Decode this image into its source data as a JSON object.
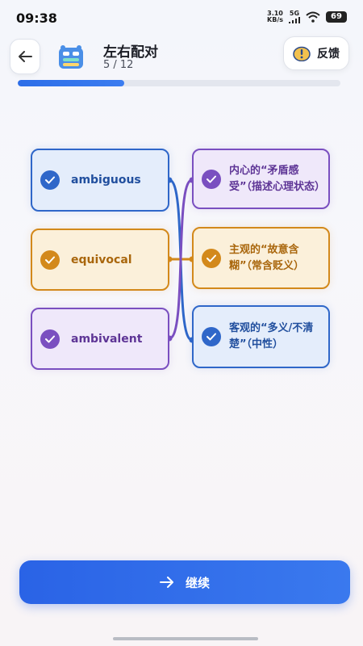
{
  "status": {
    "time": "09:38",
    "net_speed_value": "3.10",
    "net_speed_unit": "KB/s",
    "network": "5G",
    "battery": "69"
  },
  "header": {
    "title": "左右配对",
    "progress_text": "5 / 12",
    "feedback_label": "反馈",
    "progress_fraction": 0.33
  },
  "pairs": {
    "left": [
      {
        "word": "ambiguous",
        "color": "#2f67c9"
      },
      {
        "word": "equivocal",
        "color": "#d3891b"
      },
      {
        "word": "ambivalent",
        "color": "#7a4fc0"
      }
    ],
    "right": [
      {
        "text": "内心的“矛盾感受”（描述心理状态）",
        "color": "#7a4fc0"
      },
      {
        "text": "主观的“故意含糊”（常含贬义）",
        "color": "#d3891b"
      },
      {
        "text": "客观的“多义/不清楚”（中性）",
        "color": "#2f67c9"
      }
    ]
  },
  "footer": {
    "continue_label": "继续"
  },
  "icons": {
    "back": "arrow-left-icon",
    "app": "robot-mascot-icon",
    "feedback": "owl-feedback-icon",
    "check": "checkmark-icon",
    "continue": "arrow-right-icon"
  }
}
